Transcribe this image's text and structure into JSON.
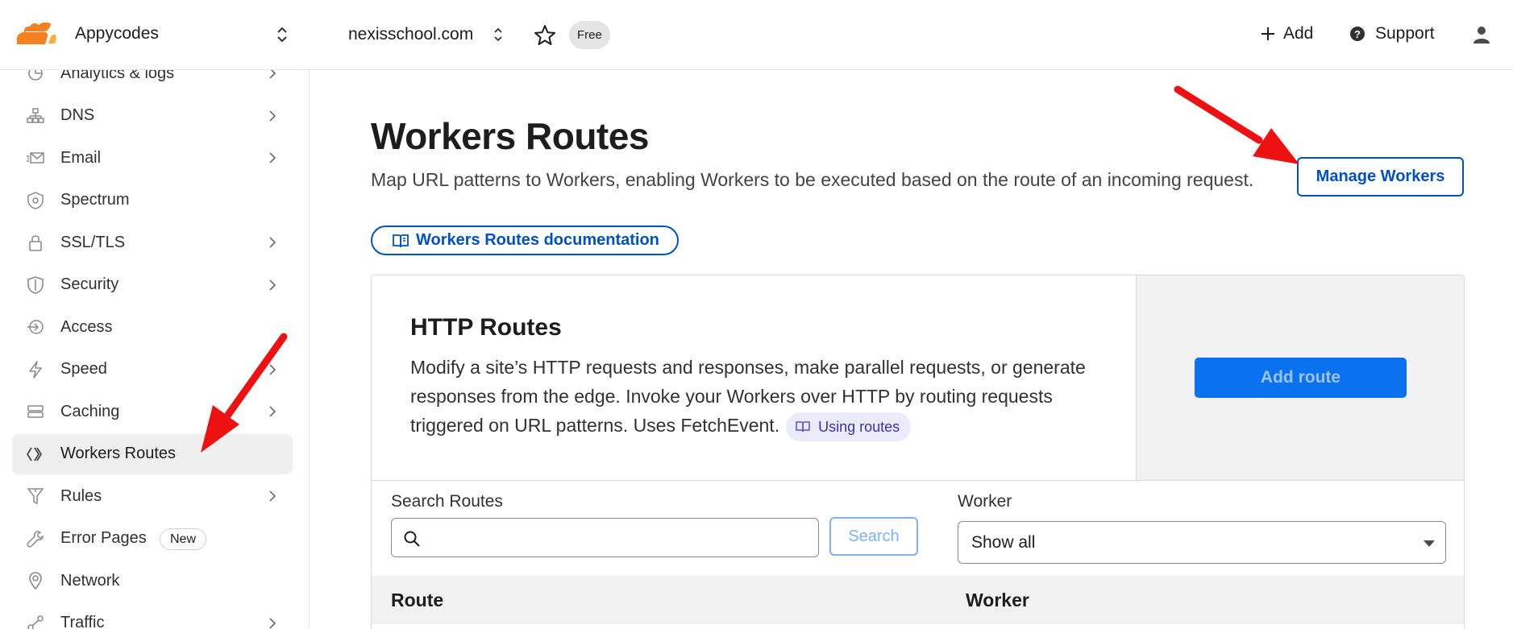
{
  "account": {
    "name": "Appycodes"
  },
  "sidebar": {
    "items": [
      {
        "label": "Analytics & logs",
        "icon": "analytics-icon",
        "chevron": true
      },
      {
        "label": "DNS",
        "icon": "dns-icon",
        "chevron": true
      },
      {
        "label": "Email",
        "icon": "email-icon",
        "chevron": true
      },
      {
        "label": "Spectrum",
        "icon": "spectrum-icon",
        "chevron": false
      },
      {
        "label": "SSL/TLS",
        "icon": "lock-icon",
        "chevron": true
      },
      {
        "label": "Security",
        "icon": "shield-icon",
        "chevron": true
      },
      {
        "label": "Access",
        "icon": "access-icon",
        "chevron": false
      },
      {
        "label": "Speed",
        "icon": "lightning-icon",
        "chevron": true
      },
      {
        "label": "Caching",
        "icon": "caching-icon",
        "chevron": true
      },
      {
        "label": "Workers Routes",
        "icon": "workers-icon",
        "chevron": false,
        "active": true
      },
      {
        "label": "Rules",
        "icon": "rules-icon",
        "chevron": true
      },
      {
        "label": "Error Pages",
        "icon": "wrench-icon",
        "chevron": false,
        "badge": "New"
      },
      {
        "label": "Network",
        "icon": "location-pin-icon",
        "chevron": false
      },
      {
        "label": "Traffic",
        "icon": "traffic-icon",
        "chevron": true
      }
    ]
  },
  "topbar": {
    "zone": "nexisschool.com",
    "plan": "Free",
    "add_label": "Add",
    "support_label": "Support"
  },
  "page": {
    "title": "Workers Routes",
    "description": "Map URL patterns to Workers, enabling Workers to be executed based on the route of an incoming request.",
    "doc_link": "Workers Routes documentation",
    "manage_button": "Manage Workers"
  },
  "http_routes": {
    "title": "HTTP Routes",
    "description": "Modify a site’s HTTP requests and responses, make parallel requests, or generate responses from the edge. Invoke your Workers over HTTP by routing requests triggered on URL patterns. Uses FetchEvent.",
    "using_routes_link": "Using routes",
    "add_route_button": "Add route"
  },
  "filters": {
    "search_label": "Search Routes",
    "search_value": "",
    "search_button": "Search",
    "worker_label": "Worker",
    "worker_selected": "Show all"
  },
  "table": {
    "columns": [
      "Route",
      "Worker"
    ]
  },
  "colors": {
    "accent": "#0051c3",
    "primary_button": "#0a72ef",
    "annotation_arrow": "#ee1111",
    "brand_orange": "#f48120"
  }
}
